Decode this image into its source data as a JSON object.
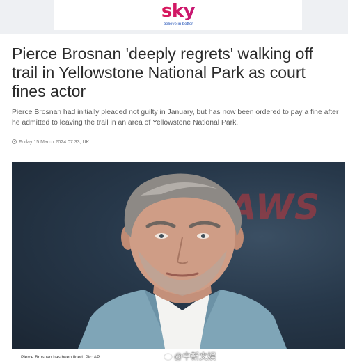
{
  "brand": {
    "name": "sky",
    "tagline": "believe in better",
    "gradient": [
      "#f0a500",
      "#e5194a",
      "#c2177a",
      "#2b5fd9"
    ]
  },
  "article": {
    "headline": "Pierce Brosnan 'deeply regrets' walking off trail in Yellowstone National Park as court fines actor",
    "standfirst": "Pierce Brosnan had initially pleaded not guilty in January, but has now been ordered to pay a fine after he admitted to leaving the trail in an area of Yellowstone National Park.",
    "date": "Friday 15 March 2024 07:33, UK",
    "date_icon": "clock-icon"
  },
  "photo": {
    "backdrop_text": "LAWS",
    "caption": "Pierce Brosnan has been fined. Pic: AP"
  },
  "watermark": {
    "text": "@中新文娱",
    "icon": "weibo-icon"
  }
}
